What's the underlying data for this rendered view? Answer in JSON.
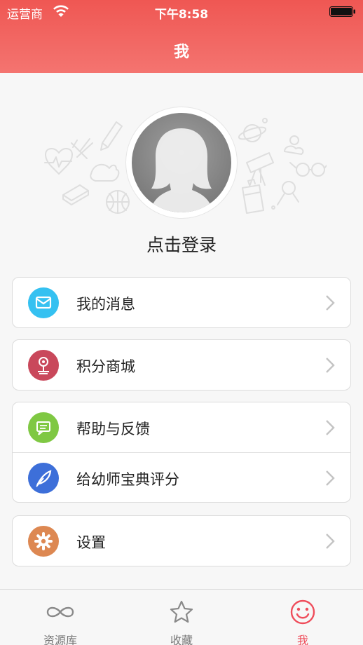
{
  "status_bar": {
    "carrier": "运营商",
    "time": "下午8:58"
  },
  "header": {
    "title": "我"
  },
  "profile": {
    "login_text": "点击登录"
  },
  "menu": {
    "messages": {
      "label": "我的消息",
      "icon": "mail-icon",
      "color": "#35c1f1"
    },
    "points_mall": {
      "label": "积分商城",
      "icon": "flower-icon",
      "color": "#c9485b"
    },
    "help_feedback": {
      "label": "帮助与反馈",
      "icon": "chat-icon",
      "color": "#7fc843"
    },
    "rate_app": {
      "label": "给幼师宝典评分",
      "icon": "feather-icon",
      "color": "#3d6fd9"
    },
    "settings": {
      "label": "设置",
      "icon": "gear-icon",
      "color": "#dd8852"
    }
  },
  "tabbar": {
    "items": [
      {
        "label": "资源库",
        "icon": "infinity-icon"
      },
      {
        "label": "收藏",
        "icon": "star-icon"
      },
      {
        "label": "我",
        "icon": "smiley-icon",
        "active": true
      }
    ],
    "active_color": "#ef4d5b"
  },
  "colors": {
    "header": "#ef5753",
    "background": "#f7f7f7"
  }
}
